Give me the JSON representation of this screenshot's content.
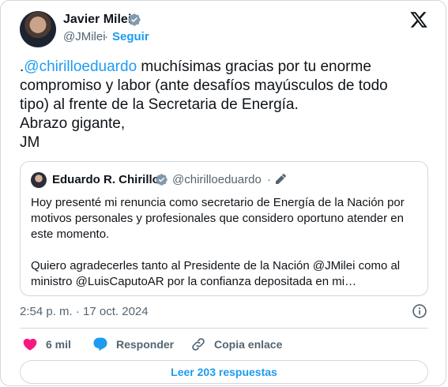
{
  "tweet": {
    "author_name": "Javier Milei",
    "handle": "@JMilei",
    "separator": "·",
    "follow_label": "Seguir",
    "text_prefix": ".",
    "text_mention": "@chirilloeduardo",
    "text_body": " muchísimas gracias por tu enorme\ncompromiso y labor (ante desafíos mayúsculos de todo\ntipo) al frente de la Secretaria de Energía.\nAbrazo gigante,\nJM",
    "timestamp": "2:54 p. m. · 17 oct. 2024"
  },
  "quote": {
    "author_name": "Eduardo R. Chirillo",
    "handle": "@chirilloeduardo",
    "separator": "·",
    "text": "Hoy presenté mi renuncia como secretario de Energía de la Nación por\nmotivos personales y profesionales que considero oportuno atender en\neste momento.\n\nQuiero agradecerles tanto al Presidente de la Nación @JMilei como al\nministro @LuisCaputoAR por la confianza depositada en mi…"
  },
  "actions": {
    "likes_count": "6 mil",
    "reply_label": "Responder",
    "copy_link_label": "Copia enlace"
  },
  "read_replies_label": "Leer 203 respuestas",
  "colors": {
    "accent": "#1d9bf0",
    "like": "#f91880",
    "text": "#0f1419",
    "muted": "#536471",
    "border": "#cfd9de"
  },
  "icons": {
    "verified": "verified-badge-icon",
    "brand": "x-logo-icon",
    "edit": "pencil-icon",
    "info": "info-icon",
    "like": "heart-icon",
    "reply": "speech-bubble-icon",
    "link": "link-icon"
  }
}
